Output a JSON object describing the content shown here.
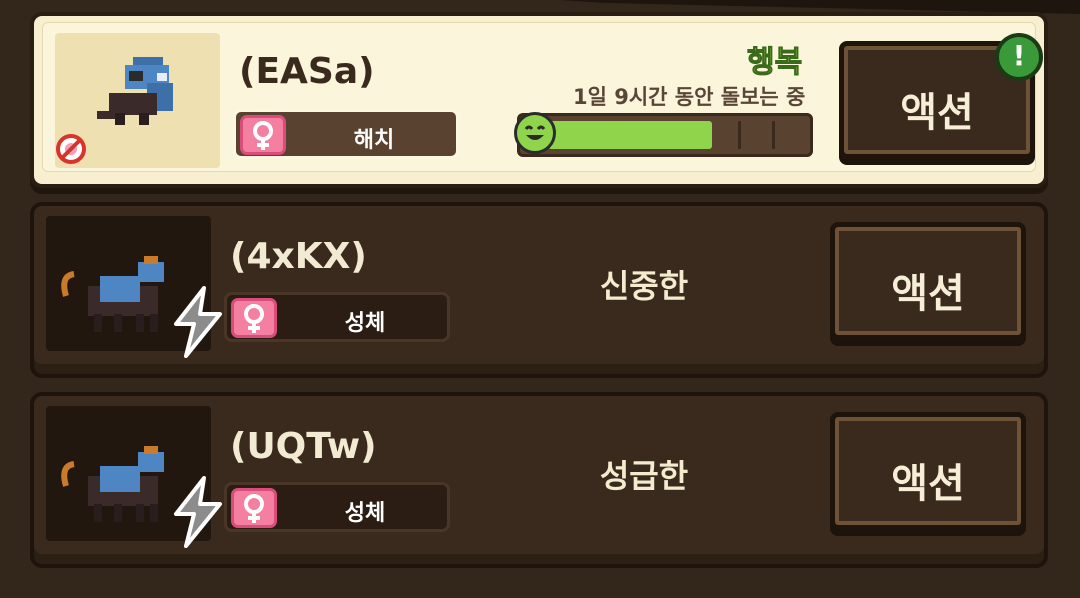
{
  "pets": [
    {
      "name": "(EASa)",
      "stage": "해치",
      "gender": "female",
      "mood": "행복",
      "care_text": "1일 9시간 동안 돌보는 중",
      "happiness_fraction": 0.75,
      "action_label": "액션",
      "alert": "!",
      "selected": true
    },
    {
      "name": "(4xKX)",
      "stage": "성체",
      "gender": "female",
      "trait": "신중한",
      "action_label": "액션",
      "selected": false
    },
    {
      "name": "(UQTw)",
      "stage": "성체",
      "gender": "female",
      "trait": "성급한",
      "action_label": "액션",
      "selected": false
    }
  ],
  "colors": {
    "background": "#33261b",
    "selected_card": "#f7efd0",
    "mood_green": "#8bc34a",
    "gender_pink": "#f47fa0"
  },
  "icons": {
    "gender": "female-symbol-icon",
    "no_breed": "no-breeding-icon",
    "evolve": "lightning-bolt-icon",
    "happy": "smiley-face-icon"
  }
}
